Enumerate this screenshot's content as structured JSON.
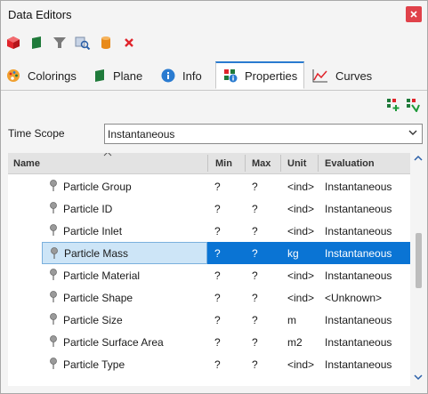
{
  "window": {
    "title": "Data Editors"
  },
  "toolbar": {
    "buttons": [
      {
        "name": "new-cube",
        "icon": "cube-icon",
        "color": "#e0242b"
      },
      {
        "name": "plane",
        "icon": "plane-flag-icon",
        "color": "#1f7a3a"
      },
      {
        "name": "filter",
        "icon": "filter-icon",
        "color": "#777777"
      },
      {
        "name": "probe",
        "icon": "probe-icon",
        "color": "#4a76b8"
      },
      {
        "name": "cylinder",
        "icon": "cylinder-icon",
        "color": "#e88a1a"
      },
      {
        "name": "delete",
        "icon": "delete-x-icon",
        "color": "#e0242b"
      }
    ]
  },
  "tabs": [
    {
      "label": "Colorings",
      "icon": "palette-icon"
    },
    {
      "label": "Plane",
      "icon": "plane-flag-icon"
    },
    {
      "label": "Info",
      "icon": "info-icon"
    },
    {
      "label": "Properties",
      "icon": "properties-icon",
      "active": true
    },
    {
      "label": "Curves",
      "icon": "curves-icon"
    }
  ],
  "properties": {
    "time_scope_label": "Time Scope",
    "time_scope_value": "Instantaneous",
    "columns": {
      "name": "Name",
      "min": "Min",
      "max": "Max",
      "unit": "Unit",
      "evaluation": "Evaluation"
    },
    "rows": [
      {
        "name": "Particle Group",
        "min": "?",
        "max": "?",
        "unit": "<ind>",
        "evaluation": "Instantaneous"
      },
      {
        "name": "Particle ID",
        "min": "?",
        "max": "?",
        "unit": "<ind>",
        "evaluation": "Instantaneous"
      },
      {
        "name": "Particle Inlet",
        "min": "?",
        "max": "?",
        "unit": "<ind>",
        "evaluation": "Instantaneous"
      },
      {
        "name": "Particle Mass",
        "min": "?",
        "max": "?",
        "unit": "kg",
        "evaluation": "Instantaneous",
        "selected": true
      },
      {
        "name": "Particle Material",
        "min": "?",
        "max": "?",
        "unit": "<ind>",
        "evaluation": "Instantaneous"
      },
      {
        "name": "Particle Shape",
        "min": "?",
        "max": "?",
        "unit": "<ind>",
        "evaluation": "<Unknown>"
      },
      {
        "name": "Particle Size",
        "min": "?",
        "max": "?",
        "unit": "m",
        "evaluation": "Instantaneous"
      },
      {
        "name": "Particle Surface Area",
        "min": "?",
        "max": "?",
        "unit": "m2",
        "evaluation": "Instantaneous"
      },
      {
        "name": "Particle Type",
        "min": "?",
        "max": "?",
        "unit": "<ind>",
        "evaluation": "Instantaneous"
      }
    ]
  },
  "colors": {
    "accent": "#0a74d4",
    "selection_light": "#cde5f7",
    "close": "#e0424a"
  }
}
